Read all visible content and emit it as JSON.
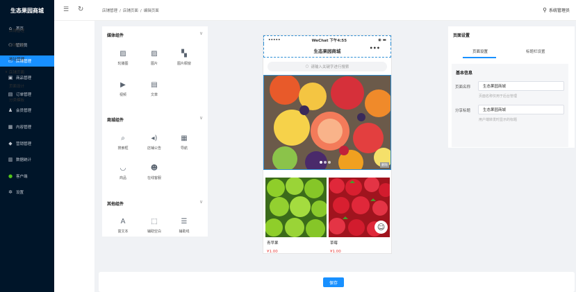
{
  "brand": "生态果园商城",
  "menu": [
    {
      "label": "首页",
      "icon": "home-icon"
    },
    {
      "label": "管理员",
      "icon": "user-gear-icon"
    },
    {
      "label": "店铺管理",
      "icon": "shop-icon"
    },
    {
      "label": "商品管理",
      "icon": "goods-icon"
    },
    {
      "label": "订单管理",
      "icon": "order-icon"
    },
    {
      "label": "会员管理",
      "icon": "member-icon"
    },
    {
      "label": "内容管理",
      "icon": "content-icon"
    },
    {
      "label": "营销管理",
      "icon": "marketing-icon"
    },
    {
      "label": "数据统计",
      "icon": "chart-icon"
    },
    {
      "label": "客户端",
      "icon": "client-icon"
    },
    {
      "label": "设置",
      "icon": "settings-icon"
    }
  ],
  "submenu": [
    "店铺管理",
    "店铺设置",
    "地址管理",
    "店铺页面",
    "页面设计",
    "分类模板"
  ],
  "breadcrumb": [
    "店铺管理",
    "/",
    "店铺页面",
    "/",
    "编辑页面"
  ],
  "user": "系统管理员",
  "widgets": {
    "media": {
      "title": "媒体组件",
      "items": [
        "轮播图",
        "图片",
        "图片橱窗",
        "视频",
        "文章"
      ]
    },
    "mall": {
      "title": "商城组件",
      "items": [
        "搜索框",
        "店铺公告",
        "导航",
        "商品",
        "在线客服"
      ]
    },
    "other": {
      "title": "其他组件",
      "items": [
        "富文本",
        "辅助空白",
        "辅助线"
      ]
    }
  },
  "phone": {
    "signal": "•••••",
    "network": "WeChat",
    "time": "下午4:55",
    "title": "生态果园商城",
    "more": "•••",
    "search_placeholder": "请输入关键字进行搜索",
    "delete": "删除",
    "products": [
      {
        "name": "青苹果",
        "price": "¥1.00"
      },
      {
        "name": "草莓",
        "price": "¥1.00"
      }
    ]
  },
  "settings": {
    "title": "页面设置",
    "tabs": [
      "页面设置",
      "标题栏设置"
    ],
    "section": "基本信息",
    "page_name_label": "页面名称",
    "page_name_value": "生态果园商城",
    "page_name_hint": "页面名称仅用于后台管理",
    "share_label": "分享标题",
    "share_value": "生态果园商城",
    "share_hint": "用户端转发时显示的标题"
  },
  "save": "保存",
  "colors": {
    "sidebar": "#001529",
    "accent": "#1890ff",
    "price": "#e53935"
  }
}
